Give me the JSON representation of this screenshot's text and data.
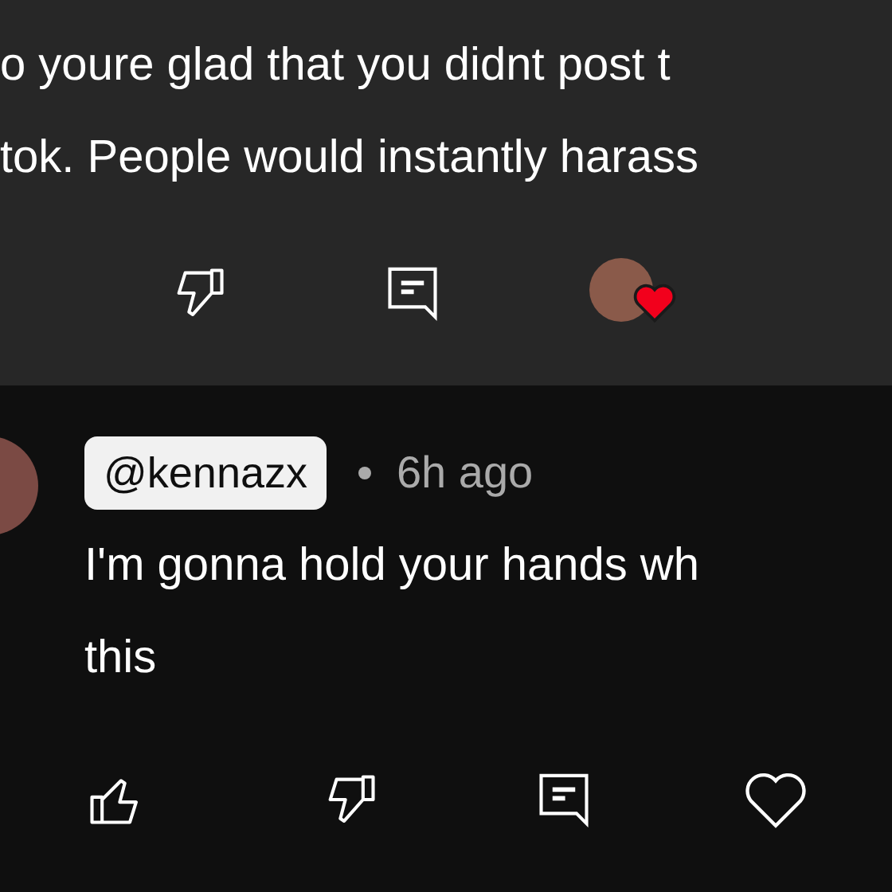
{
  "comments": [
    {
      "lines": [
        "o youre glad that you didnt post t",
        "tok. People would instantly harass"
      ],
      "hearted": true
    },
    {
      "author": "@kennazx",
      "time": "6h ago",
      "lines": [
        "I'm gonna hold your hands wh",
        "this"
      ],
      "hearted": false
    }
  ]
}
